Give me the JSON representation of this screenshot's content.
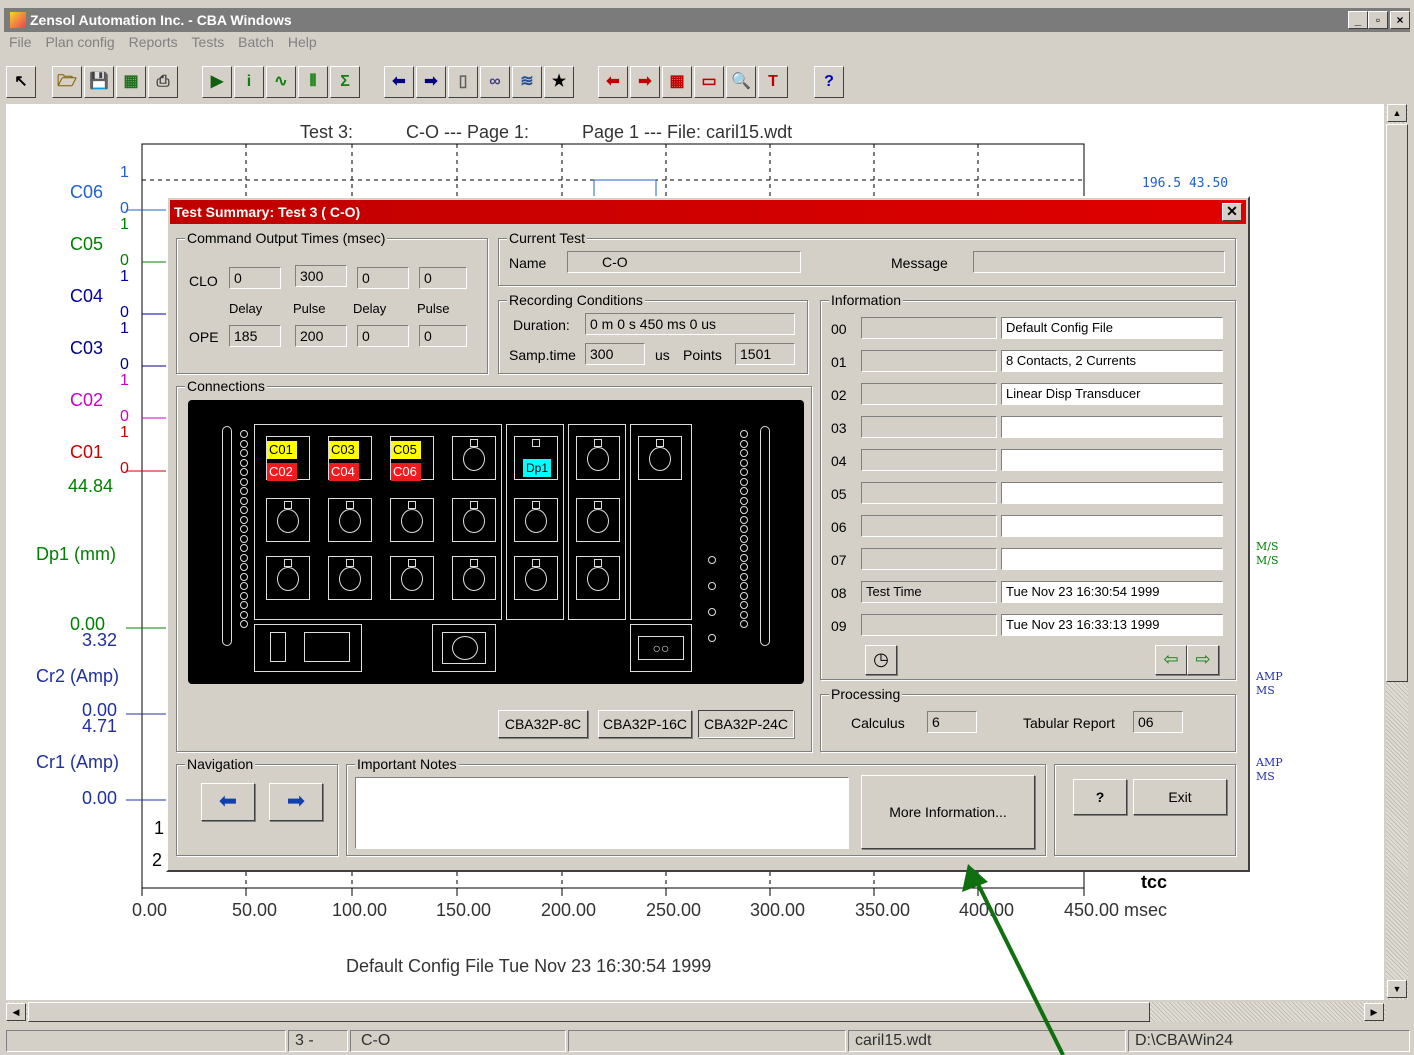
{
  "window": {
    "title": "Zensol Automation Inc. - CBA Windows"
  },
  "menu": [
    "File",
    "Plan config",
    "Reports",
    "Tests",
    "Batch",
    "Help"
  ],
  "toolbar_icons": [
    "pointer-icon",
    "open-folder-icon",
    "save-icon",
    "config-icon",
    "print-icon",
    "run-icon",
    "info-icon",
    "waveform-icon",
    "pulse-icon",
    "sigma-icon",
    "arrow-left-icon",
    "arrow-right-icon",
    "page-icon",
    "binoculars-icon",
    "signal-icon",
    "runner-icon",
    "red-left-icon",
    "red-right-icon",
    "grid-icon",
    "ruler-icon",
    "zoom-icon",
    "text-icon",
    "help-icon"
  ],
  "plot": {
    "header": [
      "Test 3:",
      "C-O --- Page 1:",
      "Page 1 --- File: caril15.wdt"
    ],
    "channels": [
      "C06",
      "C05",
      "C04",
      "C03",
      "C02",
      "C01"
    ],
    "channel_colors": {
      "C06": "#2060d0",
      "C05": "#008000",
      "C04": "#0000a0",
      "C03": "#000080",
      "C02": "#cc00cc",
      "C01": "#cc0000"
    },
    "marks": [
      "1",
      "0",
      "1",
      "0",
      "1",
      "0",
      "1",
      "0",
      "1",
      "0",
      "1",
      "0"
    ],
    "dp1_top": "44.84",
    "dp1_label": "Dp1 (mm)",
    "dp1_bottom": "0.00",
    "cr2_top": "3.32",
    "cr2_label": "Cr2 (Amp)",
    "cr2_bottom": "0.00",
    "cr1_top": "4.71",
    "cr1_label": "Cr1 (Amp)",
    "cr1_bottom": "0.00",
    "row_nums": [
      "1",
      "2"
    ],
    "x_ticks": [
      "0.00",
      "50.00",
      "100.00",
      "150.00",
      "200.00",
      "250.00",
      "300.00",
      "350.00",
      "400.00",
      "450.00 msec"
    ],
    "footer": "Default Config File   Tue Nov 23 16:30:54 1999",
    "right_readout": "196.5  43.50",
    "right_units": [
      "M/S",
      "M/S",
      "AMP",
      "MS",
      "AMP",
      "MS"
    ],
    "tcc": "tcc"
  },
  "dialog": {
    "title": "Test Summary: Test 3 (      C-O)",
    "cmd": {
      "legend": "Command Output Times (msec)",
      "clo_label": "CLO",
      "ope_label": "OPE",
      "clo": [
        "0",
        "300",
        "0",
        "0"
      ],
      "ope": [
        "185",
        "200",
        "0",
        "0"
      ],
      "cols": [
        "Delay",
        "Pulse",
        "Delay",
        "Pulse"
      ]
    },
    "current": {
      "legend": "Current Test",
      "name_label": "Name",
      "name": "C-O",
      "message_label": "Message",
      "message": ""
    },
    "recording": {
      "legend": "Recording Conditions",
      "duration_label": "Duration:",
      "duration": "0 m 0 s 450 ms 0 us",
      "samp_label": "Samp.time",
      "samp": "300",
      "us": "us",
      "points_label": "Points",
      "points": "1501"
    },
    "information": {
      "legend": "Information",
      "rows": [
        {
          "n": "00",
          "a": "",
          "b": "Default Config File"
        },
        {
          "n": "01",
          "a": "",
          "b": "8 Contacts, 2 Currents"
        },
        {
          "n": "02",
          "a": "",
          "b": "Linear Disp Transducer"
        },
        {
          "n": "03",
          "a": "",
          "b": ""
        },
        {
          "n": "04",
          "a": "",
          "b": ""
        },
        {
          "n": "05",
          "a": "",
          "b": ""
        },
        {
          "n": "06",
          "a": "",
          "b": ""
        },
        {
          "n": "07",
          "a": "",
          "b": ""
        },
        {
          "n": "08",
          "a": "Test Time",
          "b": "Tue Nov 23 16:30:54 1999"
        },
        {
          "n": "09",
          "a": "",
          "b": "Tue Nov 23 16:33:13 1999"
        }
      ]
    },
    "connections": {
      "legend": "Connections",
      "yellow": [
        "C01",
        "C03",
        "C05"
      ],
      "red": [
        "C02",
        "C04",
        "C06"
      ],
      "cyan": "Dp1",
      "models": [
        "CBA32P-8C",
        "CBA32P-16C",
        "CBA32P-24C"
      ]
    },
    "processing": {
      "legend": "Processing",
      "calculus_label": "Calculus",
      "calculus": "6",
      "tabular_label": "Tabular Report",
      "tabular": "06"
    },
    "navigation": {
      "legend": "Navigation"
    },
    "notes": {
      "legend": "Important Notes",
      "text": ""
    },
    "more_info": "More Information...",
    "help": "?",
    "exit": "Exit"
  },
  "status": [
    "3 -",
    "C-O",
    "caril15.wdt",
    "D:\\CBAWin24"
  ],
  "colors": {
    "dialog_title": "#d00000",
    "annotation_arrow": "#107010"
  }
}
